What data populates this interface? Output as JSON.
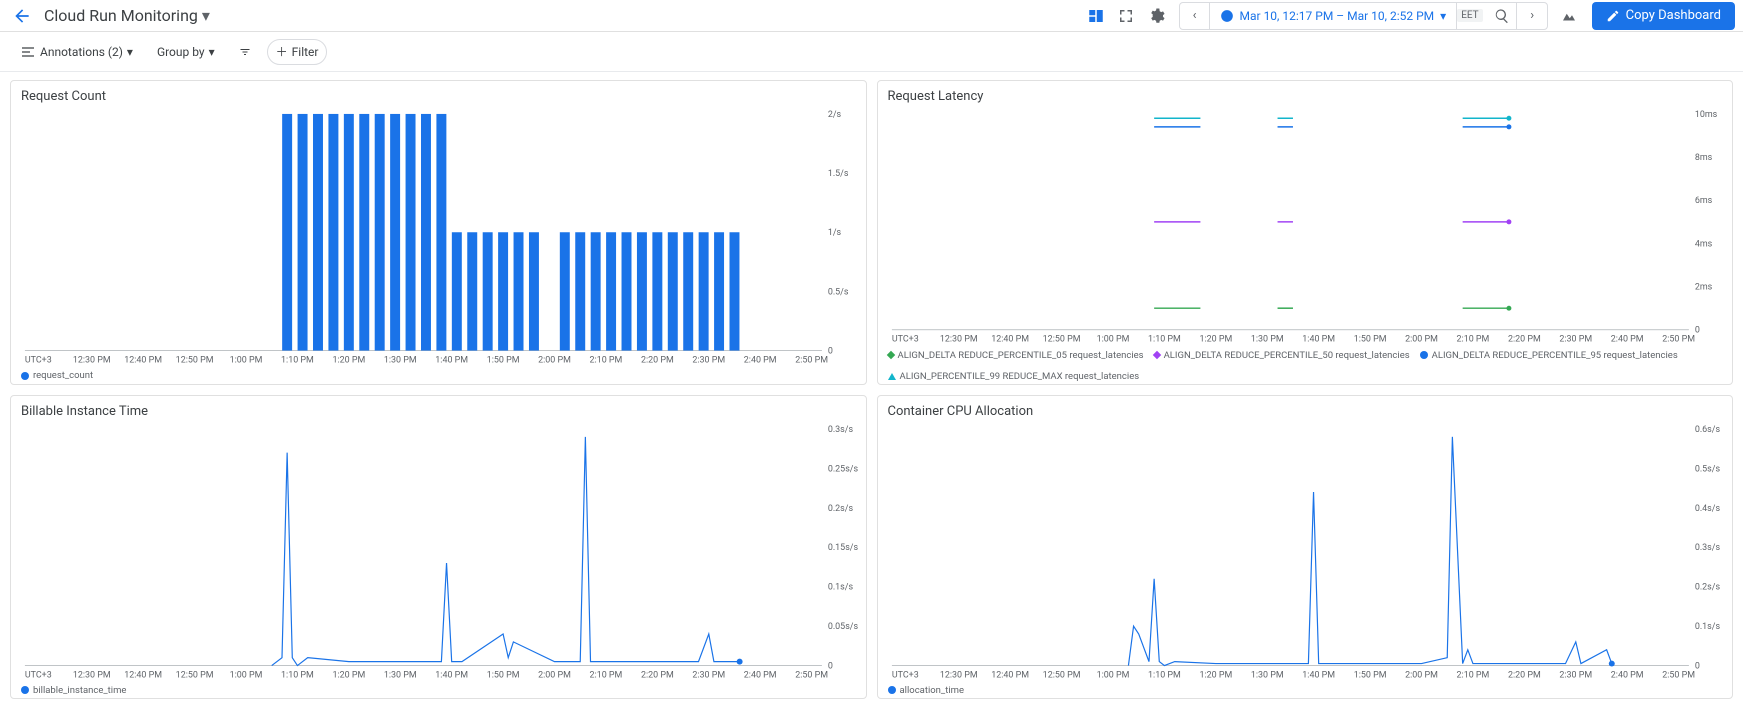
{
  "header": {
    "title": "Cloud Run Monitoring",
    "timeRange": "Mar 10, 12:17 PM – Mar 10, 2:52 PM",
    "timezone": "EET",
    "copyDashboardLabel": "Copy Dashboard"
  },
  "toolbar": {
    "annotationsLabel": "Annotations (2)",
    "groupByLabel": "Group by",
    "filterLabel": "Filter"
  },
  "axes": {
    "tz": "UTC+3",
    "xTicks": [
      "12:30 PM",
      "12:40 PM",
      "12:50 PM",
      "1:00 PM",
      "1:10 PM",
      "1:20 PM",
      "1:30 PM",
      "1:40 PM",
      "1:50 PM",
      "2:00 PM",
      "2:10 PM",
      "2:20 PM",
      "2:30 PM",
      "2:40 PM",
      "2:50 PM"
    ]
  },
  "charts": [
    {
      "title": "Request Count",
      "type": "bar",
      "yTicks": [
        "0",
        "0.5/s",
        "1/s",
        "1.5/s",
        "2/s"
      ],
      "legend": [
        {
          "label": "request_count",
          "color": "#1a73e8",
          "marker": "circle"
        }
      ]
    },
    {
      "title": "Request Latency",
      "type": "line-multi",
      "yTicks": [
        "0",
        "2ms",
        "4ms",
        "6ms",
        "8ms",
        "10ms"
      ],
      "legend": [
        {
          "label": "ALIGN_DELTA REDUCE_PERCENTILE_05 request_latencies",
          "color": "#34a853",
          "marker": "square"
        },
        {
          "label": "ALIGN_DELTA REDUCE_PERCENTILE_50 request_latencies",
          "color": "#a142f4",
          "marker": "diamond"
        },
        {
          "label": "ALIGN_DELTA REDUCE_PERCENTILE_95 request_latencies",
          "color": "#1a73e8",
          "marker": "circle"
        },
        {
          "label": "ALIGN_PERCENTILE_99 REDUCE_MAX request_latencies",
          "color": "#12b5cb",
          "marker": "triangle"
        }
      ]
    },
    {
      "title": "Billable Instance Time",
      "type": "line",
      "yTicks": [
        "0",
        "0.05s/s",
        "0.1s/s",
        "0.15s/s",
        "0.2s/s",
        "0.25s/s",
        "0.3s/s"
      ],
      "legend": [
        {
          "label": "billable_instance_time",
          "color": "#1a73e8",
          "marker": "circle"
        }
      ]
    },
    {
      "title": "Container CPU Allocation",
      "type": "line",
      "yTicks": [
        "0",
        "0.1s/s",
        "0.2s/s",
        "0.3s/s",
        "0.4s/s",
        "0.5s/s",
        "0.6s/s"
      ],
      "legend": [
        {
          "label": "allocation_time",
          "color": "#1a73e8",
          "marker": "circle"
        }
      ]
    }
  ],
  "chart_data": [
    {
      "type": "bar",
      "title": "Request Count",
      "xlabel": "",
      "ylabel": "req/s",
      "ylim": [
        0,
        2
      ],
      "x": [
        "1:08",
        "1:11",
        "1:14",
        "1:17",
        "1:20",
        "1:23",
        "1:26",
        "1:29",
        "1:32",
        "1:35",
        "1:38",
        "1:41",
        "1:44",
        "1:47",
        "1:50",
        "1:53",
        "1:56",
        "1:59",
        "2:02",
        "2:05",
        "2:08",
        "2:11",
        "2:14",
        "2:17",
        "2:20",
        "2:23",
        "2:26",
        "2:29",
        "2:32",
        "2:35"
      ],
      "values": [
        2,
        2,
        2,
        2,
        2,
        2,
        2,
        2,
        2,
        2,
        2,
        1,
        1,
        1,
        1,
        1,
        1,
        0,
        1,
        1,
        1,
        1,
        1,
        1,
        1,
        1,
        1,
        1,
        1,
        1
      ]
    },
    {
      "type": "line",
      "title": "Request Latency",
      "xlabel": "",
      "ylabel": "ms",
      "ylim": [
        0,
        10
      ],
      "x": [
        "1:08",
        "1:11",
        "1:14",
        "1:17",
        "1:32",
        "1:35",
        "2:08",
        "2:11",
        "2:14",
        "2:17"
      ],
      "series": [
        {
          "name": "p05",
          "values": [
            1.0,
            1.0,
            1.0,
            1.0,
            1.0,
            1.0,
            1.0,
            1.0,
            1.0,
            1.0
          ]
        },
        {
          "name": "p50",
          "values": [
            5.0,
            5.0,
            5.0,
            5.0,
            5.0,
            5.0,
            5.0,
            5.0,
            5.0,
            5.0
          ]
        },
        {
          "name": "p95",
          "values": [
            9.4,
            9.4,
            9.4,
            9.4,
            9.4,
            9.4,
            9.4,
            9.4,
            9.4,
            9.4
          ]
        },
        {
          "name": "p99",
          "values": [
            9.8,
            9.8,
            9.8,
            9.8,
            9.8,
            9.8,
            9.8,
            9.8,
            9.8,
            9.8
          ]
        }
      ]
    },
    {
      "type": "line",
      "title": "Billable Instance Time",
      "xlabel": "",
      "ylabel": "s/s",
      "ylim": [
        0,
        0.3
      ],
      "x": [
        "1:05",
        "1:07",
        "1:08",
        "1:09",
        "1:10",
        "1:12",
        "1:20",
        "1:30",
        "1:38",
        "1:39",
        "1:40",
        "1:42",
        "1:50",
        "1:51",
        "1:52",
        "2:00",
        "2:05",
        "2:06",
        "2:07",
        "2:08",
        "2:09",
        "2:10",
        "2:20",
        "2:28",
        "2:30",
        "2:31",
        "2:36"
      ],
      "values": [
        0,
        0.01,
        0.27,
        0.01,
        0,
        0.01,
        0.005,
        0.005,
        0.005,
        0.13,
        0.005,
        0.005,
        0.04,
        0.01,
        0.03,
        0.005,
        0.005,
        0.29,
        0.005,
        0.005,
        0.005,
        0.005,
        0.005,
        0.005,
        0.04,
        0.005,
        0.005
      ]
    },
    {
      "type": "line",
      "title": "Container CPU Allocation",
      "xlabel": "",
      "ylabel": "s/s",
      "ylim": [
        0,
        0.6
      ],
      "x": [
        "1:03",
        "1:04",
        "1:05",
        "1:07",
        "1:08",
        "1:09",
        "1:10",
        "1:12",
        "1:20",
        "1:30",
        "1:38",
        "1:39",
        "1:40",
        "1:42",
        "1:50",
        "2:00",
        "2:05",
        "2:06",
        "2:08",
        "2:09",
        "2:10",
        "2:20",
        "2:28",
        "2:30",
        "2:31",
        "2:36",
        "2:37"
      ],
      "values": [
        0,
        0.1,
        0.08,
        0.01,
        0.22,
        0.01,
        0,
        0.01,
        0.005,
        0.005,
        0.005,
        0.44,
        0.005,
        0.005,
        0.005,
        0.005,
        0.02,
        0.58,
        0.005,
        0.04,
        0.005,
        0.005,
        0.005,
        0.06,
        0.005,
        0.04,
        0.005
      ]
    }
  ]
}
